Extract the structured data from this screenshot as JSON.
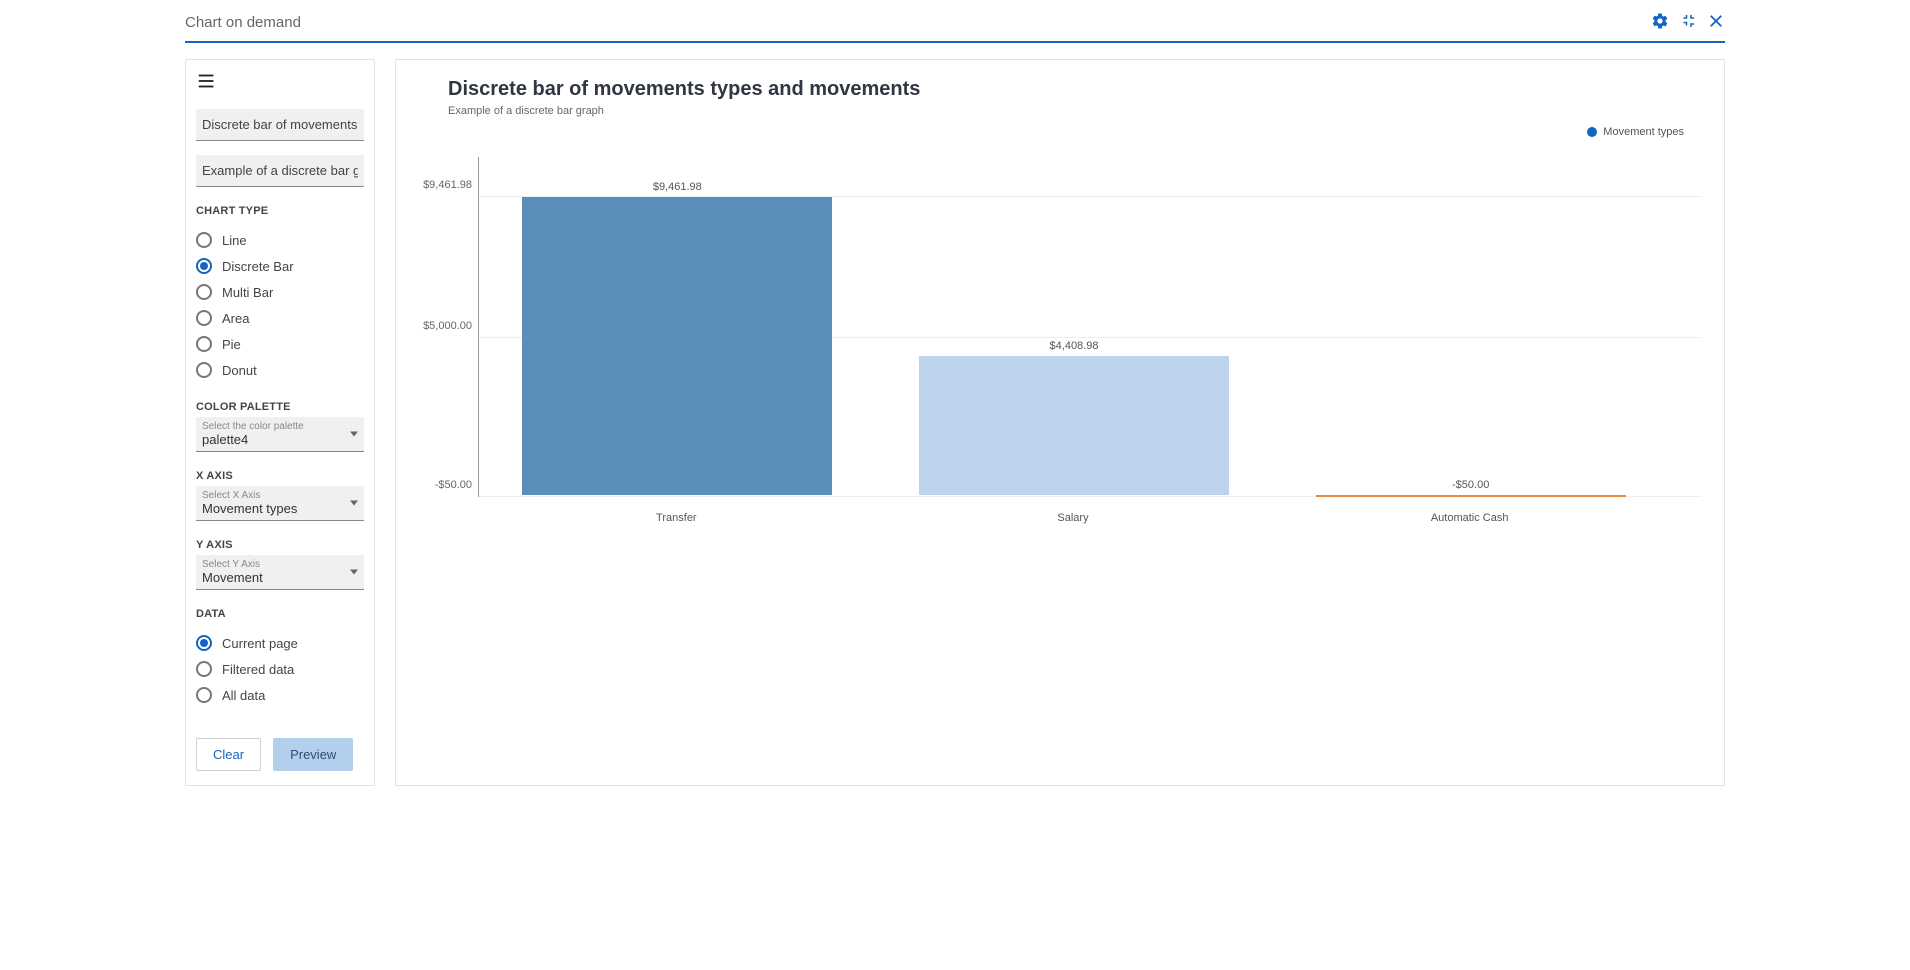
{
  "header": {
    "title": "Chart on demand"
  },
  "sidebar": {
    "title_input": "Discrete bar of movements",
    "subtitle_input": "Example of a discrete bar g",
    "chart_type": {
      "label": "CHART TYPE",
      "options": [
        "Line",
        "Discrete Bar",
        "Multi Bar",
        "Area",
        "Pie",
        "Donut"
      ],
      "selected": "Discrete Bar"
    },
    "color_palette": {
      "label": "COLOR PALETTE",
      "float": "Select the color palette",
      "value": "palette4"
    },
    "x_axis": {
      "label": "X AXIS",
      "float": "Select X Axis",
      "value": "Movement types"
    },
    "y_axis": {
      "label": "Y AXIS",
      "float": "Select Y Axis",
      "value": "Movement"
    },
    "data": {
      "label": "DATA",
      "options": [
        "Current page",
        "Filtered data",
        "All data"
      ],
      "selected": "Current page"
    },
    "clear_btn": "Clear",
    "preview_btn": "Preview"
  },
  "chart_header": {
    "title": "Discrete bar of movements types and movements",
    "subtitle": "Example of a discrete bar graph",
    "legend": "Movement types"
  },
  "chart_data": {
    "type": "bar",
    "categories": [
      "Transfer",
      "Salary",
      "Automatic Cash"
    ],
    "values": [
      9461.98,
      4408.98,
      -50.0
    ],
    "value_labels": [
      "$9,461.98",
      "$4,408.98",
      "-$50.00"
    ],
    "y_ticks": [
      "$9,461.98",
      "$5,000.00",
      "-$50.00"
    ],
    "ylim": [
      -50.0,
      9461.98
    ],
    "colors": [
      "#5b8fb9",
      "#bdd3eb",
      "#e88b3a"
    ],
    "title": "Discrete bar of movements types and movements",
    "xlabel": "",
    "ylabel": ""
  }
}
